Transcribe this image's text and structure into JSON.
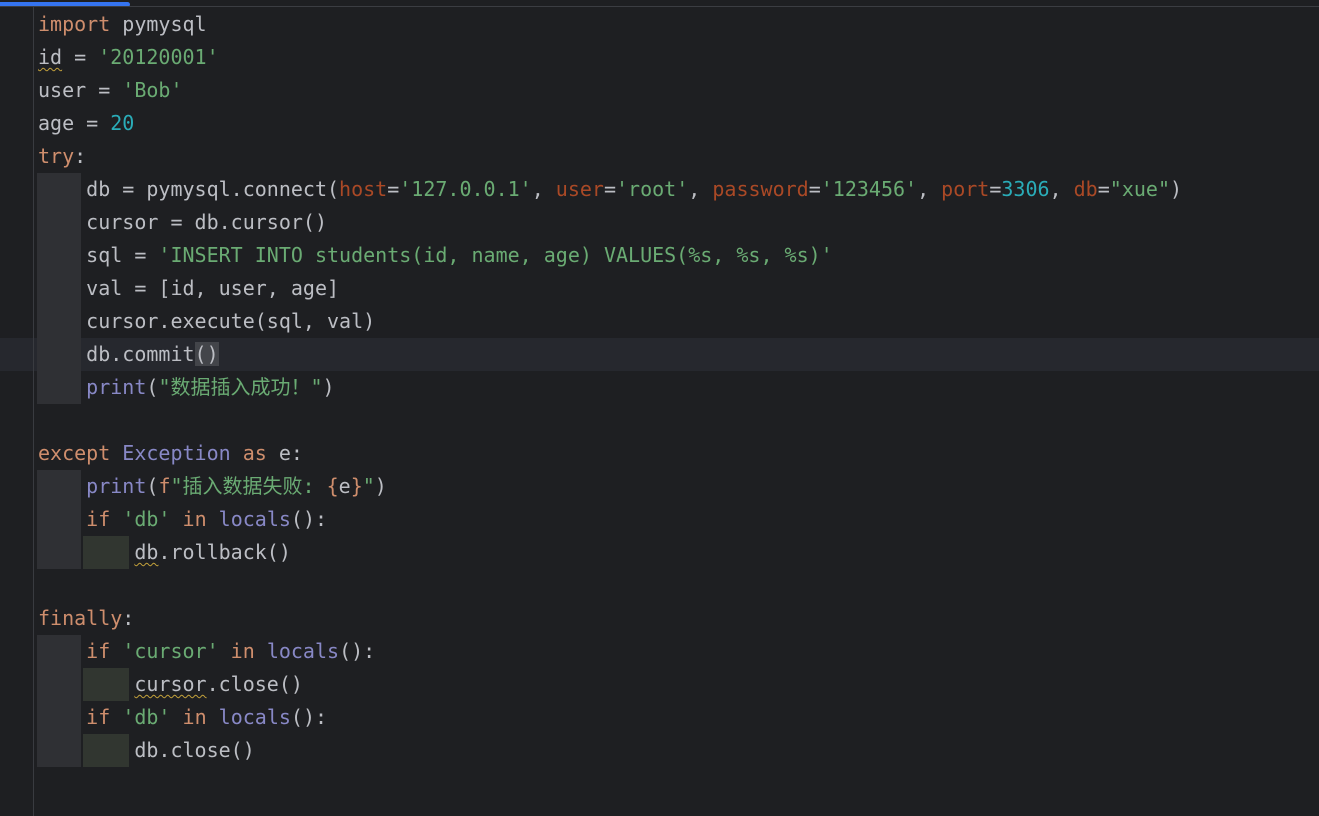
{
  "editor": {
    "language": "python",
    "caret_line": 11,
    "colors": {
      "background": "#1e1f22",
      "keyword": "#cf8e6d",
      "string": "#6aab73",
      "number": "#2aacb8",
      "named_param": "#aa4926",
      "builtin": "#8888c6",
      "default": "#bcbec4"
    },
    "lines": [
      {
        "tokens": [
          {
            "t": "import",
            "c": "kw"
          },
          {
            "t": " pymysql",
            "c": "plain"
          }
        ]
      },
      {
        "tokens": [
          {
            "t": "id",
            "c": "plain warn"
          },
          {
            "t": " = ",
            "c": "plain"
          },
          {
            "t": "'20120001'",
            "c": "str"
          }
        ]
      },
      {
        "tokens": [
          {
            "t": "user = ",
            "c": "plain"
          },
          {
            "t": "'Bob'",
            "c": "str"
          }
        ]
      },
      {
        "tokens": [
          {
            "t": "age = ",
            "c": "plain"
          },
          {
            "t": "20",
            "c": "num"
          }
        ]
      },
      {
        "tokens": [
          {
            "t": "try",
            "c": "kw"
          },
          {
            "t": ":",
            "c": "plain"
          }
        ]
      },
      {
        "tokens": [
          {
            "t": "    db = pymysql.connect(",
            "c": "plain"
          },
          {
            "t": "host",
            "c": "param"
          },
          {
            "t": "=",
            "c": "plain"
          },
          {
            "t": "'127.0.0.1'",
            "c": "str"
          },
          {
            "t": ", ",
            "c": "plain"
          },
          {
            "t": "user",
            "c": "param"
          },
          {
            "t": "=",
            "c": "plain"
          },
          {
            "t": "'root'",
            "c": "str"
          },
          {
            "t": ", ",
            "c": "plain"
          },
          {
            "t": "password",
            "c": "param"
          },
          {
            "t": "=",
            "c": "plain"
          },
          {
            "t": "'123456'",
            "c": "str"
          },
          {
            "t": ", ",
            "c": "plain"
          },
          {
            "t": "port",
            "c": "param"
          },
          {
            "t": "=",
            "c": "plain"
          },
          {
            "t": "3306",
            "c": "num"
          },
          {
            "t": ", ",
            "c": "plain"
          },
          {
            "t": "db",
            "c": "param"
          },
          {
            "t": "=",
            "c": "plain"
          },
          {
            "t": "\"xue\"",
            "c": "str"
          },
          {
            "t": ")",
            "c": "plain"
          }
        ]
      },
      {
        "tokens": [
          {
            "t": "    cursor = db.cursor()",
            "c": "plain"
          }
        ]
      },
      {
        "tokens": [
          {
            "t": "    sql = ",
            "c": "plain"
          },
          {
            "t": "'INSERT INTO students(id, name, age) VALUES(%s, %s, %s)'",
            "c": "str"
          }
        ]
      },
      {
        "tokens": [
          {
            "t": "    val = [id, user, age]",
            "c": "plain"
          }
        ]
      },
      {
        "tokens": [
          {
            "t": "    cursor.execute(sql, val)",
            "c": "plain"
          }
        ]
      },
      {
        "tokens": [
          {
            "t": "    db.commit",
            "c": "plain"
          },
          {
            "t": "()",
            "c": "plain brace-hl"
          }
        ]
      },
      {
        "tokens": [
          {
            "t": "    ",
            "c": "plain"
          },
          {
            "t": "print",
            "c": "builtin"
          },
          {
            "t": "(",
            "c": "plain"
          },
          {
            "t": "\"数据插入成功！\"",
            "c": "str"
          },
          {
            "t": ")",
            "c": "plain"
          }
        ]
      },
      {
        "tokens": []
      },
      {
        "tokens": [
          {
            "t": "except ",
            "c": "kw"
          },
          {
            "t": "Exception",
            "c": "builtin"
          },
          {
            "t": " as",
            "c": "kw"
          },
          {
            "t": " e:",
            "c": "plain"
          }
        ]
      },
      {
        "tokens": [
          {
            "t": "    ",
            "c": "plain"
          },
          {
            "t": "print",
            "c": "builtin"
          },
          {
            "t": "(",
            "c": "plain"
          },
          {
            "t": "f",
            "c": "kw"
          },
          {
            "t": "\"插入数据失败: ",
            "c": "str"
          },
          {
            "t": "{",
            "c": "kw"
          },
          {
            "t": "e",
            "c": "plain"
          },
          {
            "t": "}",
            "c": "kw"
          },
          {
            "t": "\"",
            "c": "str"
          },
          {
            "t": ")",
            "c": "plain"
          }
        ]
      },
      {
        "tokens": [
          {
            "t": "    ",
            "c": "plain"
          },
          {
            "t": "if",
            "c": "kw"
          },
          {
            "t": " ",
            "c": "plain"
          },
          {
            "t": "'db'",
            "c": "str"
          },
          {
            "t": " in",
            "c": "kw"
          },
          {
            "t": " ",
            "c": "plain"
          },
          {
            "t": "locals",
            "c": "builtin"
          },
          {
            "t": "():",
            "c": "plain"
          }
        ]
      },
      {
        "tokens": [
          {
            "t": "        ",
            "c": "plain"
          },
          {
            "t": "db",
            "c": "plain warn"
          },
          {
            "t": ".rollback()",
            "c": "plain"
          }
        ]
      },
      {
        "tokens": []
      },
      {
        "tokens": [
          {
            "t": "finally",
            "c": "kw"
          },
          {
            "t": ":",
            "c": "plain"
          }
        ]
      },
      {
        "tokens": [
          {
            "t": "    ",
            "c": "plain"
          },
          {
            "t": "if",
            "c": "kw"
          },
          {
            "t": " ",
            "c": "plain"
          },
          {
            "t": "'cursor'",
            "c": "str"
          },
          {
            "t": " in",
            "c": "kw"
          },
          {
            "t": " ",
            "c": "plain"
          },
          {
            "t": "locals",
            "c": "builtin"
          },
          {
            "t": "():",
            "c": "plain"
          }
        ]
      },
      {
        "tokens": [
          {
            "t": "        ",
            "c": "plain"
          },
          {
            "t": "cursor",
            "c": "plain warn"
          },
          {
            "t": ".close()",
            "c": "plain"
          }
        ]
      },
      {
        "tokens": [
          {
            "t": "    ",
            "c": "plain"
          },
          {
            "t": "if",
            "c": "kw"
          },
          {
            "t": " ",
            "c": "plain"
          },
          {
            "t": "'db'",
            "c": "str"
          },
          {
            "t": " in",
            "c": "kw"
          },
          {
            "t": " ",
            "c": "plain"
          },
          {
            "t": "locals",
            "c": "builtin"
          },
          {
            "t": "():",
            "c": "plain"
          }
        ]
      },
      {
        "tokens": [
          {
            "t": "        db.close()",
            "c": "plain"
          }
        ]
      }
    ]
  }
}
